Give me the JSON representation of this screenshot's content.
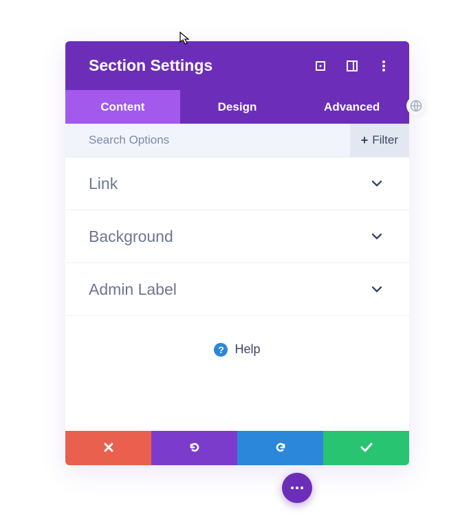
{
  "header": {
    "title": "Section Settings"
  },
  "tabs": [
    {
      "label": "Content",
      "active": true
    },
    {
      "label": "Design",
      "active": false
    },
    {
      "label": "Advanced",
      "active": false
    }
  ],
  "search": {
    "placeholder": "Search Options",
    "value": ""
  },
  "filter_button": {
    "label": "Filter"
  },
  "panels": [
    {
      "title": "Link"
    },
    {
      "title": "Background"
    },
    {
      "title": "Admin Label"
    }
  ],
  "help": {
    "label": "Help",
    "icon_char": "?"
  },
  "footer": {
    "cancel_title": "Cancel",
    "undo_title": "Undo",
    "redo_title": "Redo",
    "save_title": "Save"
  },
  "colors": {
    "purple": "#6c2eb9",
    "purple_light": "#a259ec",
    "red": "#e9604f",
    "blue": "#2b87da",
    "green": "#29c471"
  }
}
